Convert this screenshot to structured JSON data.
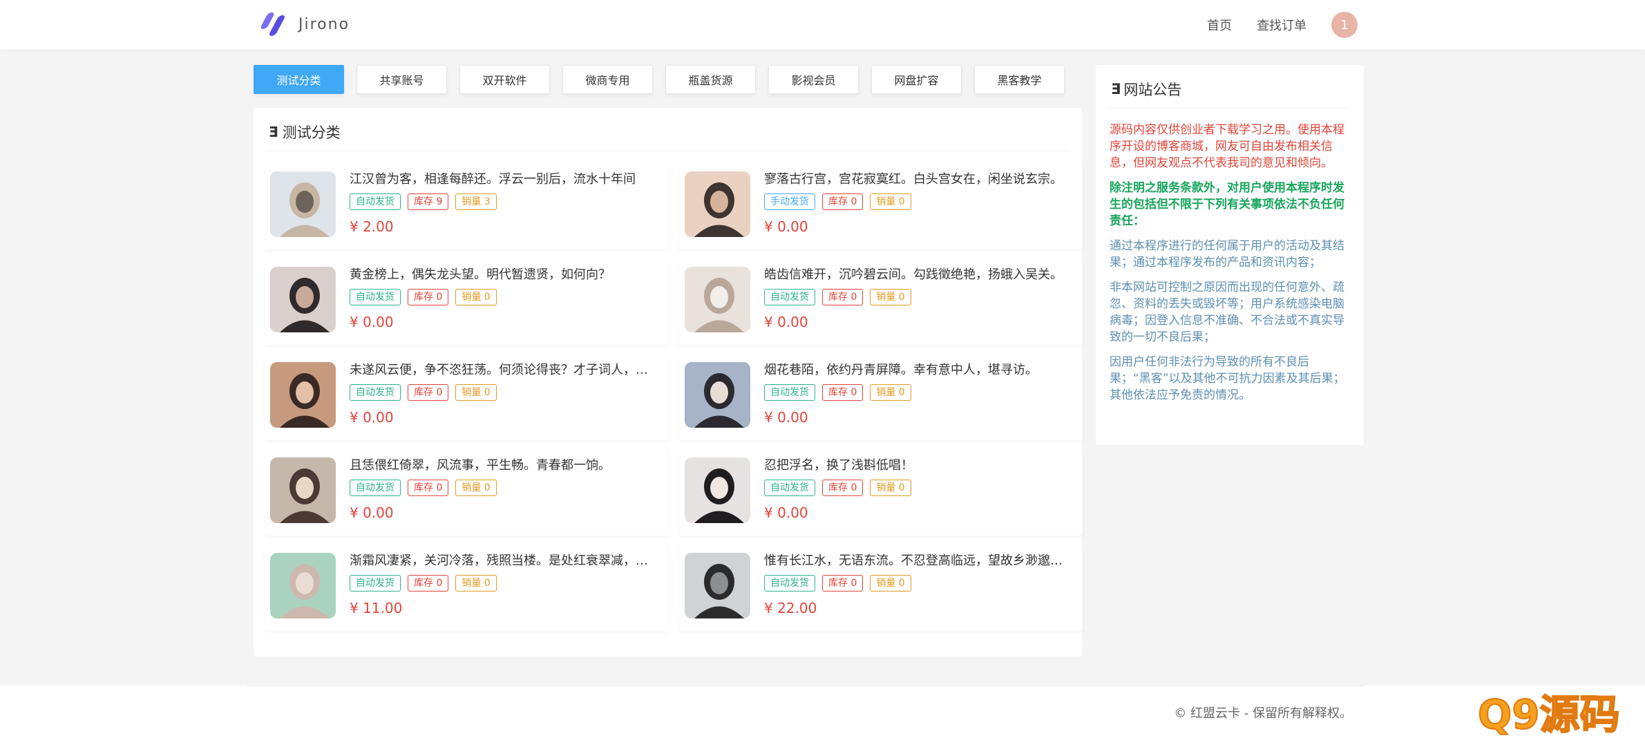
{
  "header": {
    "brand": "Jirono",
    "nav": [
      "首页",
      "查找订单"
    ],
    "avatar": "1"
  },
  "tabs": [
    "测试分类",
    "共享账号",
    "双开软件",
    "微商专用",
    "瓶盖货源",
    "影视会员",
    "网盘扩容",
    "黑客教学"
  ],
  "main": {
    "title": "测试分类",
    "products": [
      {
        "title": "江汉曾为客，相逢每醉还。浮云一别后，流水十年间",
        "delivery": "自动发货",
        "delivery_type": "auto",
        "stock": "库存 9",
        "sales": "销量 3",
        "price": "¥ 2.00"
      },
      {
        "title": "寥落古行宫，宫花寂寞红。白头宫女在，闲坐说玄宗。",
        "delivery": "手动发货",
        "delivery_type": "manual",
        "stock": "库存 0",
        "sales": "销量 0",
        "price": "¥ 0.00"
      },
      {
        "title": "黄金榜上，偶失龙头望。明代暂遗贤，如何向？",
        "delivery": "自动发货",
        "delivery_type": "auto",
        "stock": "库存 0",
        "sales": "销量 0",
        "price": "¥ 0.00"
      },
      {
        "title": "皓齿信难开，沉吟碧云间。勾践徵绝艳，扬蛾入吴关。",
        "delivery": "自动发货",
        "delivery_type": "auto",
        "stock": "库存 0",
        "sales": "销量 0",
        "price": "¥ 0.00"
      },
      {
        "title": "未遂风云便，争不恣狂荡。何须论得丧？才子词人，自是白衣卿相。",
        "delivery": "自动发货",
        "delivery_type": "auto",
        "stock": "库存 0",
        "sales": "销量 0",
        "price": "¥ 0.00"
      },
      {
        "title": "烟花巷陌，依约丹青屏障。幸有意中人，堪寻访。",
        "delivery": "自动发货",
        "delivery_type": "auto",
        "stock": "库存 0",
        "sales": "销量 0",
        "price": "¥ 0.00"
      },
      {
        "title": "且恁偎红倚翠，风流事，平生畅。青春都一饷。",
        "delivery": "自动发货",
        "delivery_type": "auto",
        "stock": "库存 0",
        "sales": "销量 0",
        "price": "¥ 0.00"
      },
      {
        "title": "忍把浮名，换了浅斟低唱！",
        "delivery": "自动发货",
        "delivery_type": "auto",
        "stock": "库存 0",
        "sales": "销量 0",
        "price": "¥ 0.00"
      },
      {
        "title": "渐霜风凄紧，关河冷落，残照当楼。是处红衰翠减，苒苒物华休。",
        "delivery": "自动发货",
        "delivery_type": "auto",
        "stock": "库存 0",
        "sales": "销量 0",
        "price": "¥ 11.00"
      },
      {
        "title": "惟有长江水，无语东流。不忍登高临远，望故乡渺邈，归思难收。",
        "delivery": "自动发货",
        "delivery_type": "auto",
        "stock": "库存 0",
        "sales": "销量 0",
        "price": "¥ 22.00"
      }
    ]
  },
  "notice": {
    "title": "网站公告",
    "paragraphs": [
      {
        "text": "源码内容仅供创业者下载学习之用。使用本程序开设的博客商城，网友可自由发布相关信息，但网友观点不代表我司的意见和倾向。",
        "style": "red"
      },
      {
        "text": "除注明之服务条款外，对用户使用本程序时发生的包括但不限于下列有关事项依法不负任何责任：",
        "style": "green"
      },
      {
        "text": "通过本程序进行的任何属于用户的活动及其结果；通过本程序发布的产品和资讯内容；",
        "style": "gray"
      },
      {
        "text": "非本网站可控制之原因而出现的任何意外、疏忽、资料的丢失或毁坏等；用户系统感染电脑病毒；因登入信息不准确、不合法或不真实导致的一切不良后果；",
        "style": "gray"
      },
      {
        "text": "因用户任何非法行为导致的所有不良后果；“黑客”以及其他不可抗力因素及其后果；其他依法应予免责的情况。",
        "style": "gray"
      }
    ]
  },
  "footer": {
    "copyright": "© 红盟云卡 - 保留所有解释权。",
    "watermark": "Q9源码"
  },
  "colors": {
    "accent": "#3fa8f7",
    "price": "#e0443a",
    "auto": "#2bb38c",
    "sales": "#e19a22"
  }
}
